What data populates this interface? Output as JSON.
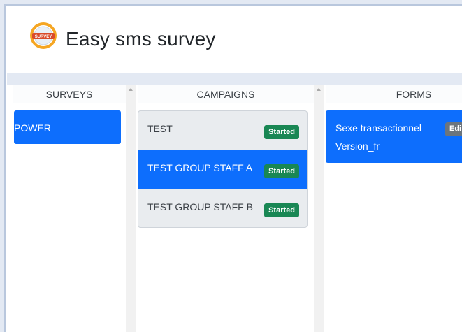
{
  "app": {
    "title": "Easy sms survey",
    "logo_text": "SURVEY"
  },
  "columns": {
    "surveys": {
      "header": "SURVEYS",
      "items": [
        {
          "label": "POWER",
          "selected": true
        }
      ]
    },
    "campaigns": {
      "header": "CAMPAIGNS",
      "items": [
        {
          "label": "TEST",
          "status": "Started",
          "selected": false
        },
        {
          "label": "TEST GROUP STAFF A",
          "status": "Started",
          "selected": true
        },
        {
          "label": "TEST GROUP STAFF B",
          "status": "Started",
          "selected": false
        }
      ]
    },
    "forms": {
      "header": "FORMS",
      "items": [
        {
          "name": "Sexe transactionnel",
          "version": "Version_fr",
          "action": "Edit"
        }
      ]
    }
  },
  "colors": {
    "primary": "#0d6efd",
    "success": "#198754",
    "secondary": "#6c757d"
  }
}
